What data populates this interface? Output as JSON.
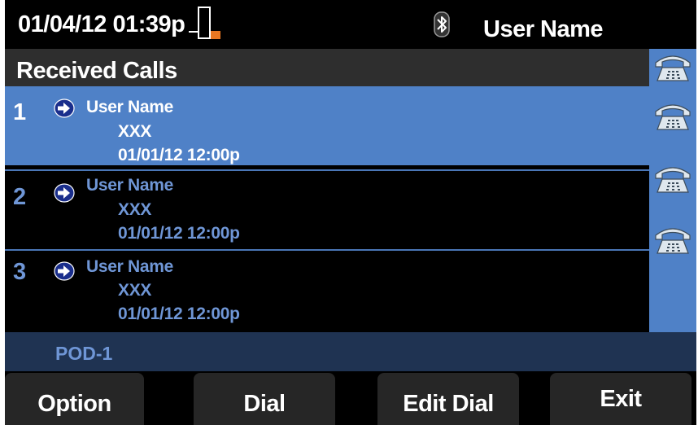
{
  "header": {
    "datetime": "01/04/12 01:39p",
    "user_name": "User Name",
    "bluetooth_icon": "bluetooth-icon",
    "line_status_icon": "line-status-icon"
  },
  "title": "Received Calls",
  "calls": [
    {
      "index": "1",
      "name": "User Name",
      "number": "XXX",
      "time": "01/01/12 12:00p",
      "selected": true
    },
    {
      "index": "2",
      "name": "User Name",
      "number": "XXX",
      "time": "01/01/12 12:00p",
      "selected": false
    },
    {
      "index": "3",
      "name": "User Name",
      "number": "XXX",
      "time": "01/01/12 12:00p",
      "selected": false
    }
  ],
  "line_buttons": [
    "phone-icon",
    "phone-icon",
    "phone-icon",
    "phone-icon"
  ],
  "pod_label": "POD-1",
  "softkeys": {
    "option": "Option",
    "dial": "Dial",
    "edit_dial": "Edit Dial",
    "exit": "Exit"
  },
  "colors": {
    "background": "#000000",
    "selected_row": "#4f81c7",
    "unselected_text": "#6f96d6",
    "pod_bar": "#1f3352",
    "title_bar": "#2e2e2e",
    "softkey": "#262626",
    "accent_orange": "#e87722",
    "arrow_icon": "#1a2e8c"
  }
}
